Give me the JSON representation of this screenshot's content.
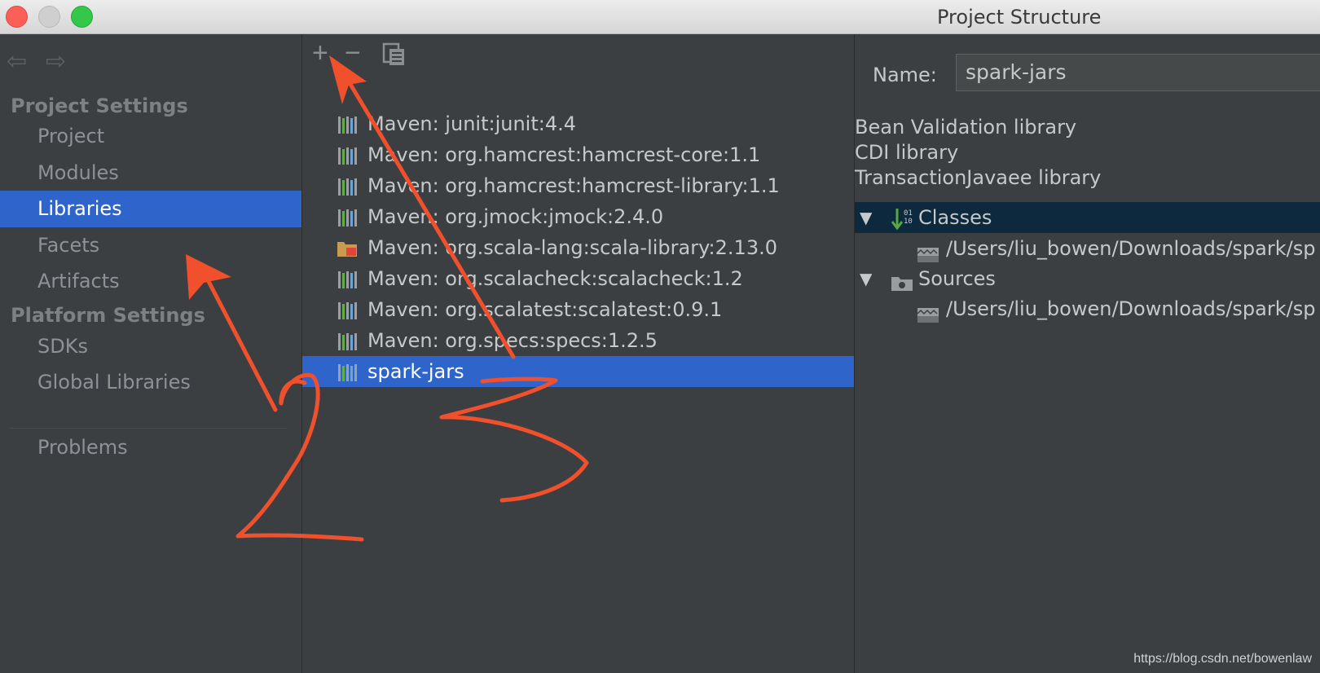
{
  "window": {
    "title": "Project Structure"
  },
  "sidebar": {
    "project_settings_header": "Project Settings",
    "platform_settings_header": "Platform Settings",
    "items": {
      "project": "Project",
      "modules": "Modules",
      "libraries": "Libraries",
      "facets": "Facets",
      "artifacts": "Artifacts",
      "sdks": "SDKs",
      "global_libraries": "Global Libraries",
      "problems": "Problems"
    },
    "selected": "Libraries"
  },
  "libraries": {
    "list": [
      "Maven: junit:junit:4.4",
      "Maven: org.hamcrest:hamcrest-core:1.1",
      "Maven: org.hamcrest:hamcrest-library:1.1",
      "Maven: org.jmock:jmock:2.4.0",
      "Maven: org.scala-lang:scala-library:2.13.0",
      "Maven: org.scalacheck:scalacheck:1.2",
      "Maven: org.scalatest:scalatest:0.9.1",
      "Maven: org.specs:specs:1.2.5",
      "spark-jars"
    ],
    "selected": "spark-jars"
  },
  "detail": {
    "name_label": "Name:",
    "name_value": "spark-jars",
    "info": [
      "Bean Validation library",
      "CDI library",
      "TransactionJavaee library"
    ],
    "classes_label": "Classes",
    "classes_path": "/Users/liu_bowen/Downloads/spark/sp",
    "sources_label": "Sources",
    "sources_path": "/Users/liu_bowen/Downloads/spark/sp"
  },
  "watermark": "https://blog.csdn.net/bowenlaw",
  "colors": {
    "selection": "#2f65ca",
    "annotation": "#f0502b",
    "classes_highlight": "#0d293e"
  }
}
